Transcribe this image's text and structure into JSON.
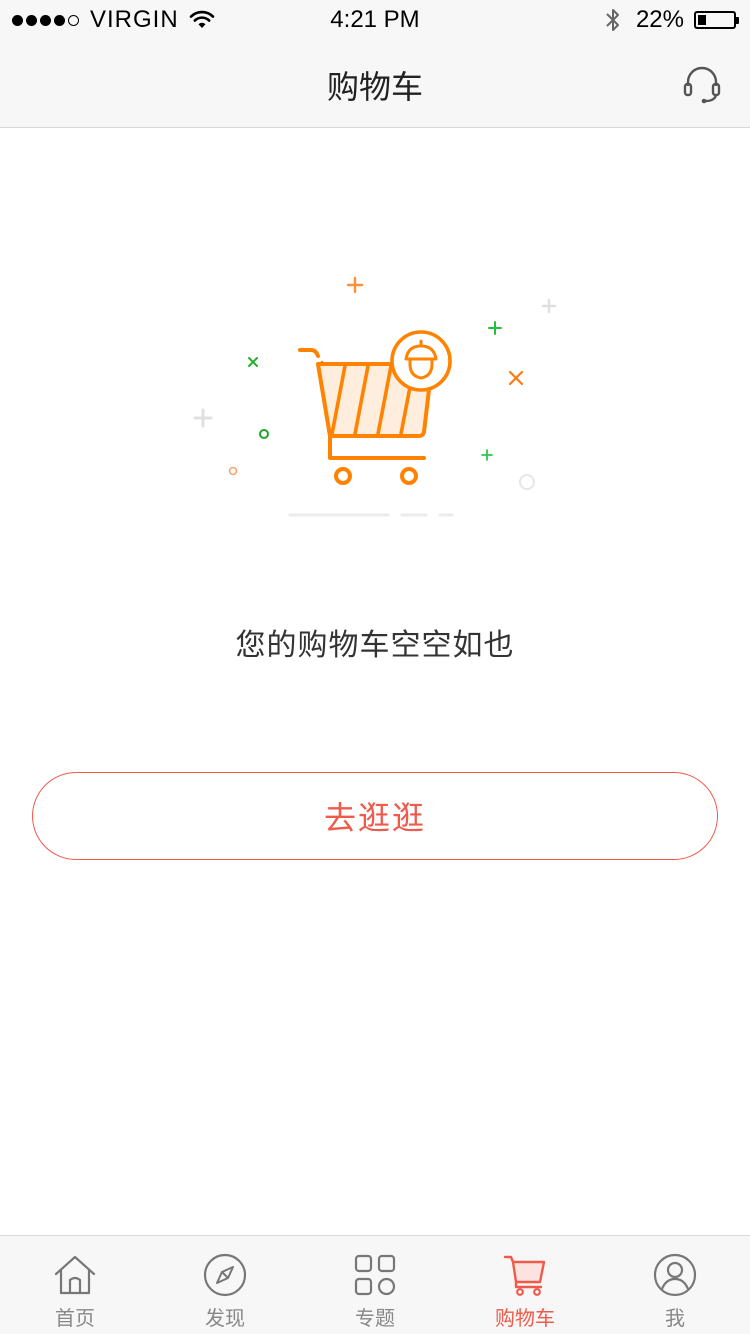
{
  "status_bar": {
    "carrier": "VIRGIN",
    "time": "4:21 PM",
    "battery_percent": "22%",
    "battery_level": 0.22,
    "signal_bars_filled": 4,
    "signal_bars_total": 5
  },
  "nav": {
    "title": "购物车",
    "right_icon": "headset-icon"
  },
  "empty_state": {
    "illustration": "shopping-cart-icon",
    "message": "您的购物车空空如也",
    "button_label": "去逛逛"
  },
  "tabs": [
    {
      "label": "首页",
      "icon": "home-icon",
      "active": false
    },
    {
      "label": "发现",
      "icon": "compass-icon",
      "active": false
    },
    {
      "label": "专题",
      "icon": "grid-icon",
      "active": false
    },
    {
      "label": "购物车",
      "icon": "cart-icon",
      "active": true
    },
    {
      "label": "我",
      "icon": "profile-icon",
      "active": false
    }
  ],
  "colors": {
    "accent": "#f05a4a",
    "illustration_orange": "#ff8200",
    "tab_inactive": "#888888",
    "bar_background": "#f7f7f7"
  }
}
